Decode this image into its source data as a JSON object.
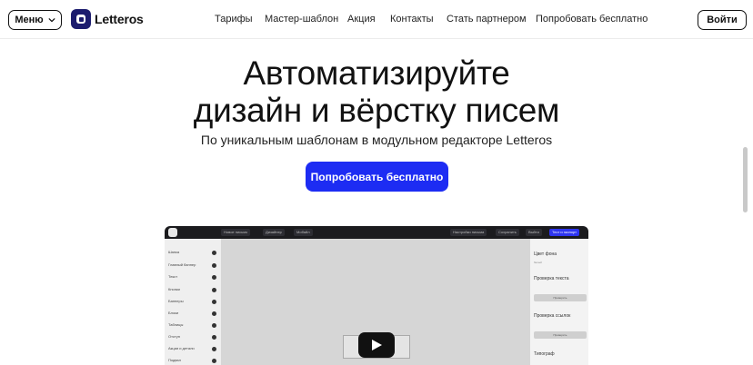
{
  "header": {
    "menu_label": "Меню",
    "logo_text": "Letteros",
    "nav": [
      "Тарифы",
      "Мастер-шаблон",
      "Акция",
      "Контакты",
      "Стать партнером",
      "Попробовать бесплатно"
    ],
    "login_label": "Войти"
  },
  "hero": {
    "title_line1": "Автоматизируйте",
    "title_line2": "дизайн и вёрстку писем",
    "subtitle": "По уникальным шаблонам в модульном редакторе Letteros",
    "cta_label": "Попробовать бесплатно"
  },
  "video": {
    "topbar": {
      "chip1": "Новое письмо",
      "chip2": "Дизайнер",
      "chip3": "Мобайл",
      "chip4": "Настройки письма",
      "chip5": "Сохранить",
      "chip6": "Выйти",
      "chip7": "Тест и экспорт"
    },
    "sidebar": [
      "Шапка",
      "Главный баннер",
      "Текст",
      "Кнопки",
      "Баннеры",
      "Блоки",
      "Таблицы",
      "Отступ",
      "Акции и детали",
      "Подвал"
    ],
    "right_panel": {
      "bg_color_label": "Цвет фона",
      "bg_color_value": "белый",
      "check_text_label": "Проверка текста",
      "check_text_btn": "Проверить",
      "check_links_label": "Проверка ссылок",
      "check_links_btn": "Проверить",
      "typograph_label": "Типограф"
    }
  },
  "colors": {
    "accent": "#1d2cf3",
    "logo": "#1c1c6e",
    "video_topbar": "#1b1b1e"
  }
}
